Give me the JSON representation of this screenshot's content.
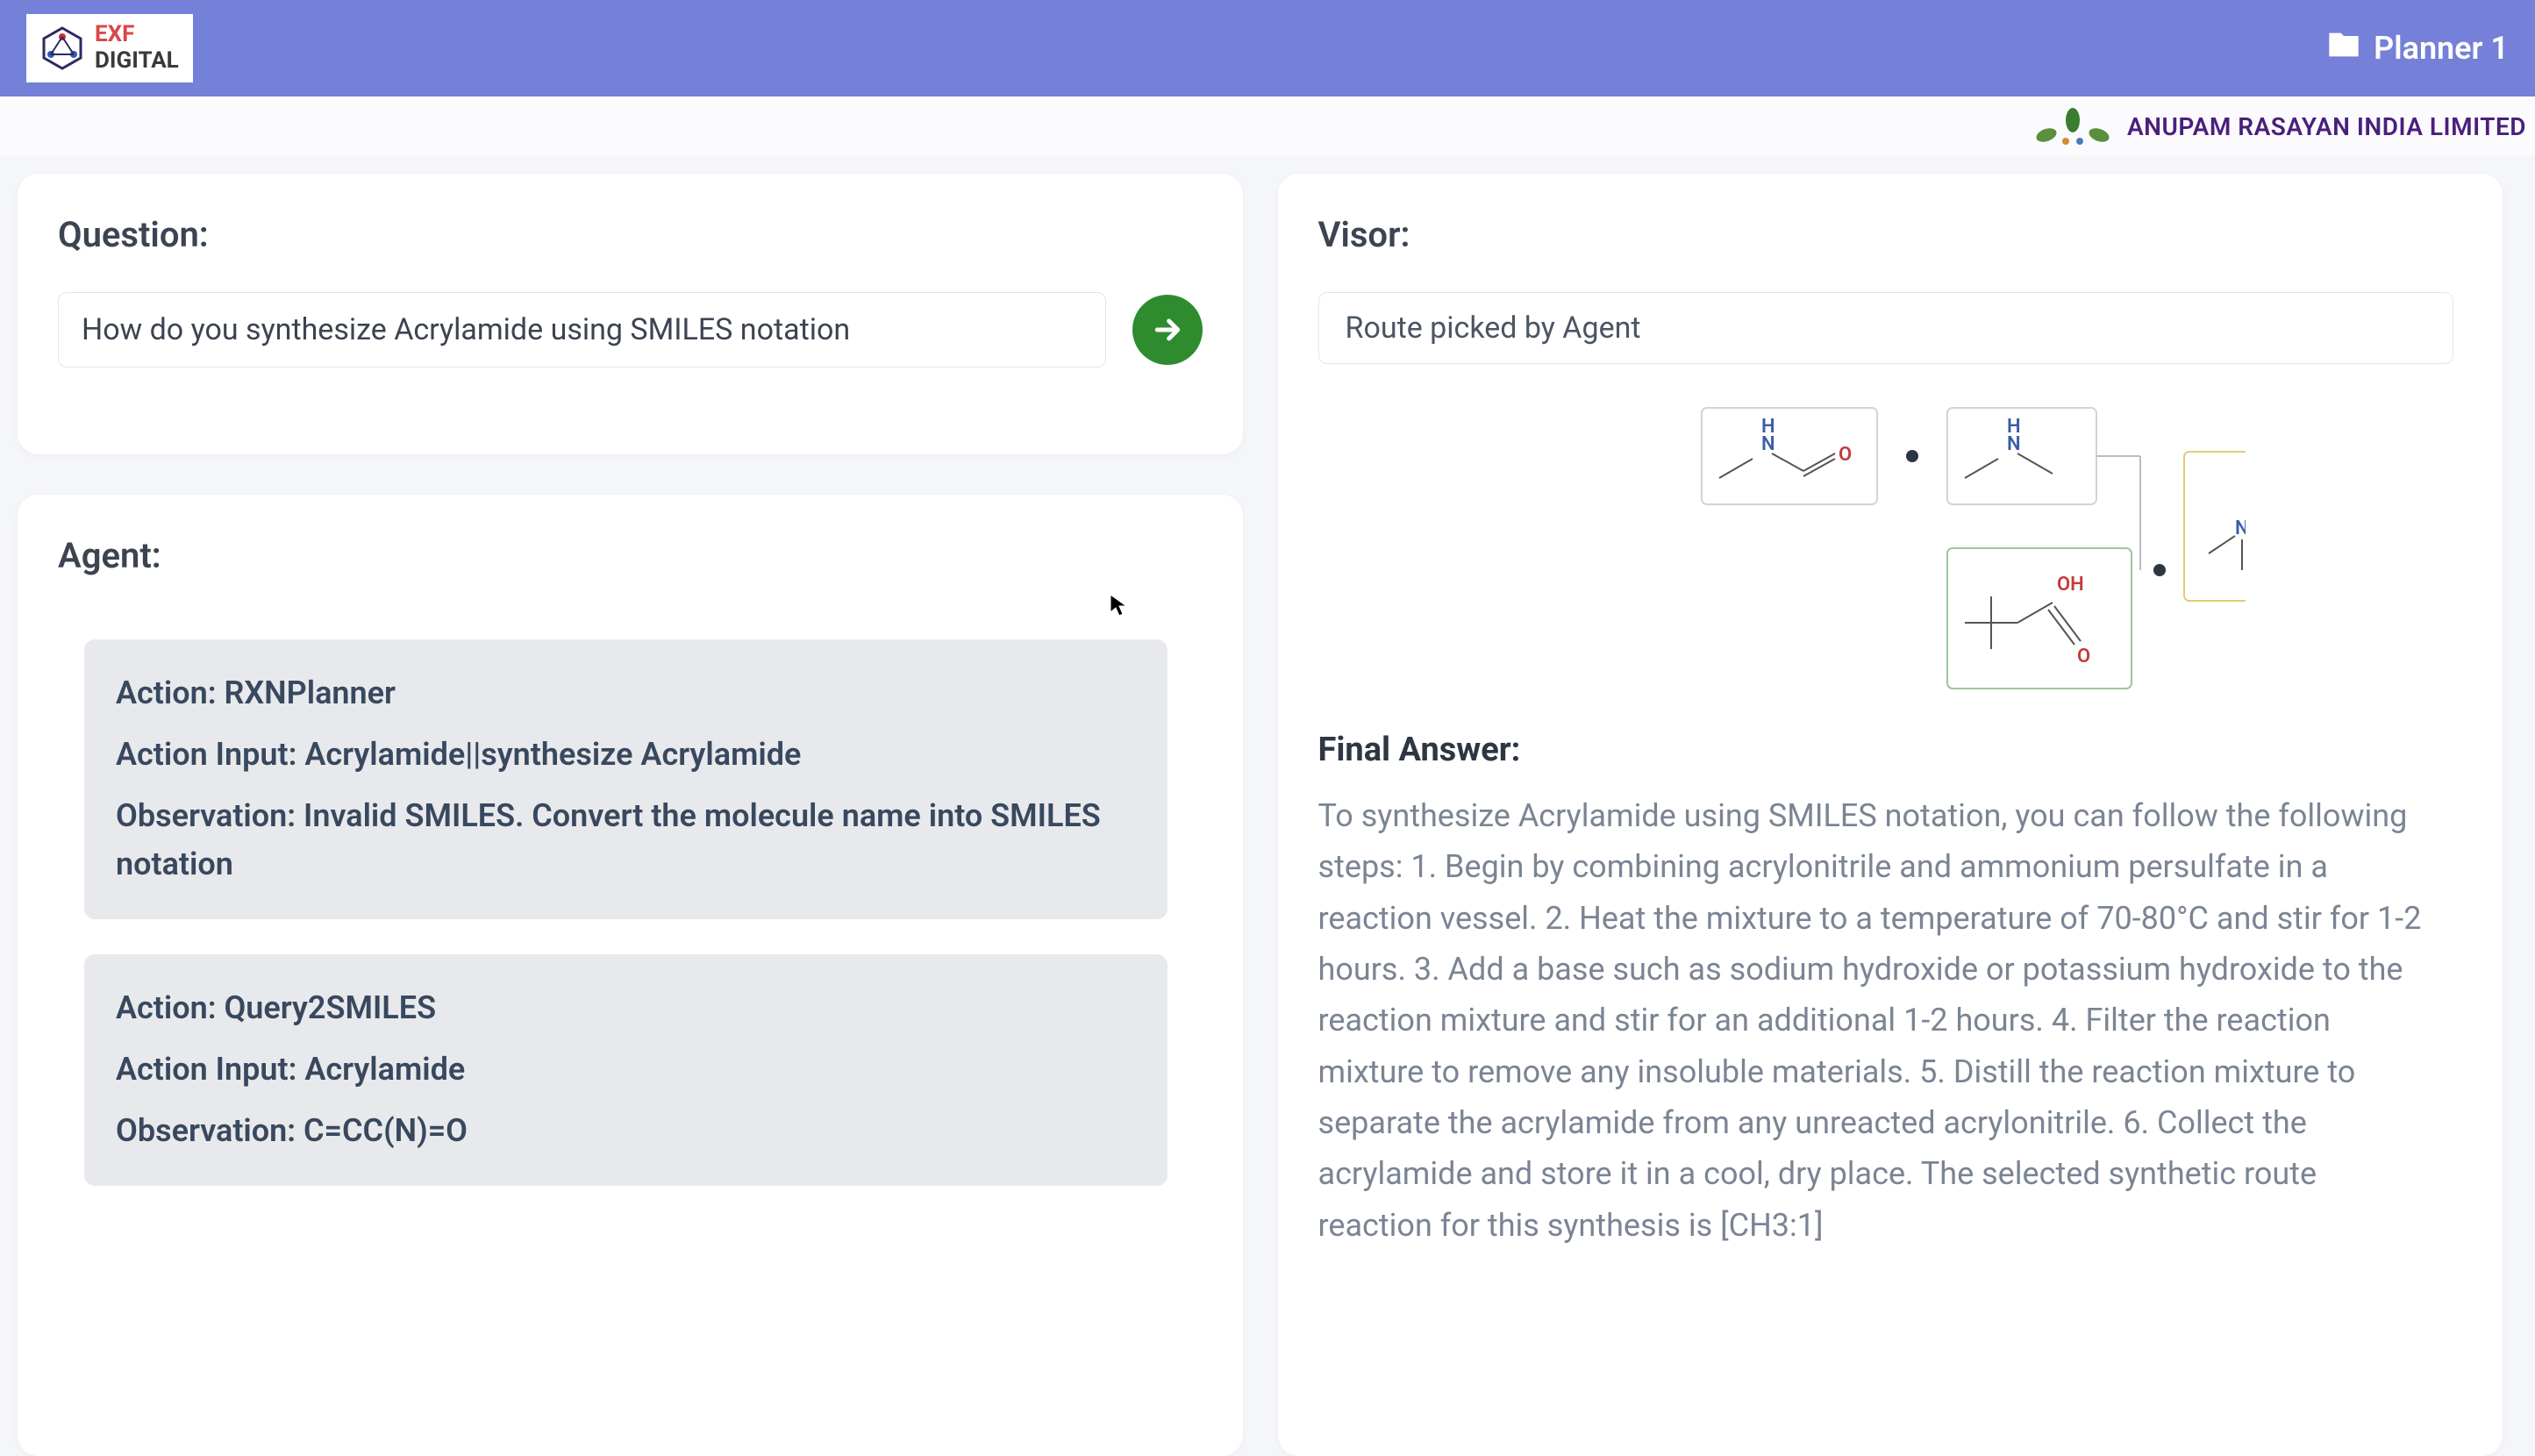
{
  "header": {
    "logo_top": "EXF",
    "logo_bottom": "DIGITAL",
    "planner_label": "Planner 1"
  },
  "subheader": {
    "company_name": "ANUPAM RASAYAN INDIA LIMITED"
  },
  "question": {
    "title": "Question:",
    "value": "How do you synthesize Acrylamide using SMILES notation"
  },
  "agent": {
    "title": "Agent:",
    "steps": [
      {
        "action": "Action: RXNPlanner",
        "input": "Action Input: Acrylamide||synthesize Acrylamide",
        "observation": "Observation: Invalid SMILES. Convert the molecule name into SMILES notation"
      },
      {
        "action": "Action: Query2SMILES",
        "input": "Action Input: Acrylamide",
        "observation": "Observation: C=CC(N)=O"
      }
    ]
  },
  "visor": {
    "title": "Visor:",
    "route_label": "Route picked by Agent",
    "final_answer_title": "Final Answer:",
    "final_answer_text": "To synthesize Acrylamide using SMILES notation, you can follow the following steps: 1. Begin by combining acrylonitrile and ammonium persulfate in a reaction vessel. 2. Heat the mixture to a temperature of 70-80°C and stir for 1-2 hours. 3. Add a base such as sodium hydroxide or potassium hydroxide to the reaction mixture and stir for an additional 1-2 hours. 4. Filter the reaction mixture to remove any insoluble materials. 5. Distill the reaction mixture to separate the acrylamide from any unreacted acrylonitrile. 6. Collect the acrylamide and store it in a cool, dry place. The selected synthetic route reaction for this synthesis is [CH3:1]"
  }
}
